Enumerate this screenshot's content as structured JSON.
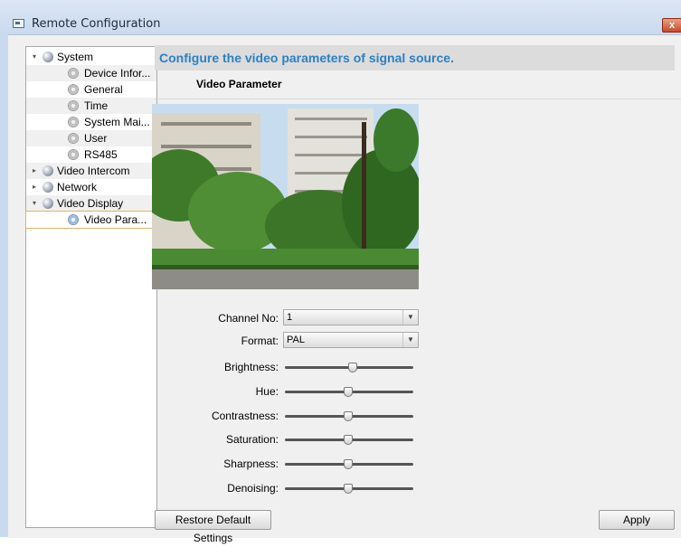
{
  "window": {
    "title": "Remote Configuration",
    "close_glyph": "x"
  },
  "tree": {
    "items": [
      {
        "label": "System",
        "level": 0,
        "icon": "globe-icon",
        "expander": "expanded"
      },
      {
        "label": "Device Infor...",
        "level": 1,
        "icon": "gear-icon"
      },
      {
        "label": "General",
        "level": 1,
        "icon": "gear-icon"
      },
      {
        "label": "Time",
        "level": 1,
        "icon": "gear-icon"
      },
      {
        "label": "System Mai...",
        "level": 1,
        "icon": "gear-icon"
      },
      {
        "label": "User",
        "level": 1,
        "icon": "gear-icon"
      },
      {
        "label": "RS485",
        "level": 1,
        "icon": "gear-icon"
      },
      {
        "label": "Video Intercom",
        "level": 0,
        "icon": "globe-icon",
        "expander": "collapsed"
      },
      {
        "label": "Network",
        "level": 0,
        "icon": "globe-icon",
        "expander": "collapsed"
      },
      {
        "label": "Video Display",
        "level": 0,
        "icon": "globe-icon",
        "expander": "expanded"
      },
      {
        "label": "Video Para...",
        "level": 1,
        "icon": "gear-icon",
        "selected": true
      }
    ]
  },
  "main": {
    "banner": "Configure the video parameters of signal source.",
    "section_title": "Video Parameter",
    "channel": {
      "label": "Channel No:",
      "value": "1"
    },
    "format": {
      "label": "Format:",
      "value": "PAL"
    },
    "sliders": [
      {
        "label": "Brightness:",
        "level": 0.53
      },
      {
        "label": "Hue:",
        "level": 0.49
      },
      {
        "label": "Contrastness:",
        "level": 0.49
      },
      {
        "label": "Saturation:",
        "level": 0.49
      },
      {
        "label": "Sharpness:",
        "level": 0.49
      },
      {
        "label": "Denoising:",
        "level": 0.49
      }
    ],
    "restore_label": "Restore Default Settings",
    "apply_label": "Apply"
  },
  "colors": {
    "banner_text": "#2c80c5",
    "selected_outline": "#e1b26a",
    "close": "#c9472a"
  }
}
